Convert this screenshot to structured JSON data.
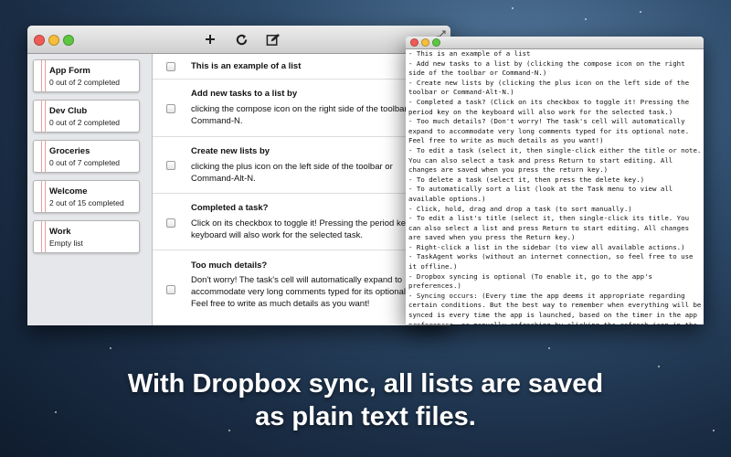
{
  "lists": [
    {
      "name": "App Form",
      "sub": "0 out of 2 completed"
    },
    {
      "name": "Dev Club",
      "sub": "0 out of 2 completed"
    },
    {
      "name": "Groceries",
      "sub": "0 out of 7 completed"
    },
    {
      "name": "Welcome",
      "sub": "2 out of 15 completed"
    },
    {
      "name": "Work",
      "sub": "Empty list"
    }
  ],
  "toolbar": {
    "add_icon": "plus-icon",
    "refresh_icon": "refresh-icon",
    "compose_icon": "compose-icon"
  },
  "tasks": [
    {
      "title": "This is an example of a list",
      "note": ""
    },
    {
      "title": "Add new tasks to a list by",
      "note": "clicking the compose icon on the right side of the toolbar or\nCommand-N."
    },
    {
      "title": "Create new lists by",
      "note": "clicking the plus icon on the left side of the toolbar or\nCommand-Alt-N."
    },
    {
      "title": "Completed a task?",
      "note": "Click on its checkbox to toggle it! Pressing the period key on\nkeyboard will also work for the selected task."
    },
    {
      "title": "Too much details?",
      "note": "Don't worry! The task's cell will automatically expand to\naccommodate very long comments typed for its optional note.\nFeel free to write as much details as you want!"
    }
  ],
  "text_file": "- This is an example of a list\n- Add new tasks to a list by (clicking the compose icon on the right\nside of the toolbar or Command-N.)\n- Create new lists by (clicking the plus icon on the left side of the\ntoolbar or Command-Alt-N.)\n- Completed a task? (Click on its checkbox to toggle it! Pressing the\nperiod key on the keyboard will also work for the selected task.)\n- Too much details? (Don't worry! The task's cell will automatically\nexpand to accommodate very long comments typed for its optional note.\nFeel free to write as much details as you want!)\n- To edit a task (select it, then single-click either the title or note.\nYou can also select a task and press Return to start editing. All\nchanges are saved when you press the return key.)\n- To delete a task (select it, then press the delete key.)\n- To automatically sort a list (look at the Task menu to view all\navailable options.)\n- Click, hold, drag and drop a task (to sort manually.)\n- To edit a list's title (select it, then single-click its title. You\ncan also select a list and press Return to start editing. All changes\nare saved when you press the Return key.)\n- Right-click a list in the sidebar (to view all available actions.)\n- TaskAgent works (without an internet connection, so feel free to use\nit offline.)\n- Dropbox syncing is optional (To enable it, go to the app's\npreferences.)\n- Syncing occurs: (Every time the app deems it appropriate regarding\ncertain conditions. But the best way to remember when everything will be\nsynced is every time the app is launched, based on the timer in the app\npreferences, or manually refreshing by clicking the refresh icon in the\ncenter of the toolbar.)\n- That's pretty much it!",
  "caption": {
    "line1": "With Dropbox sync, all lists are saved",
    "line2": "as plain text files."
  }
}
